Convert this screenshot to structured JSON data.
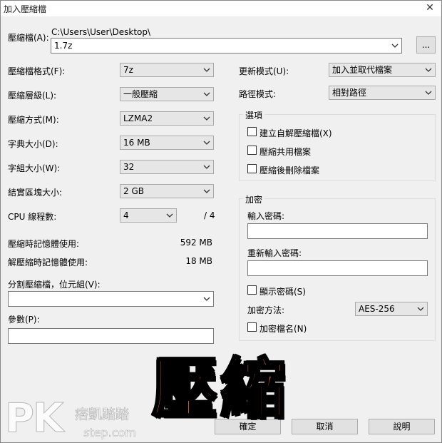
{
  "window": {
    "title": "加入壓縮檔",
    "close_glyph": "✕"
  },
  "archive": {
    "label": "壓縮檔(A):",
    "path": "C:\\Users\\User\\Desktop\\",
    "filename": "1.7z",
    "browse_label": "..."
  },
  "left": {
    "format": {
      "label": "壓縮檔格式(F):",
      "value": "7z"
    },
    "level": {
      "label": "壓縮層級(L):",
      "value": "一般壓縮"
    },
    "method": {
      "label": "壓縮方式(M):",
      "value": "LZMA2"
    },
    "dict": {
      "label": "字典大小(D):",
      "value": "16 MB"
    },
    "word": {
      "label": "字組大小(W):",
      "value": "32"
    },
    "solid": {
      "label": "結實區塊大小:",
      "value": "2 GB"
    },
    "threads": {
      "label": "CPU 線程數:",
      "value": "4",
      "max": "/ 4"
    },
    "mem_comp": {
      "label": "壓縮時記憶體使用:",
      "value": "592 MB"
    },
    "mem_decomp": {
      "label": "解壓縮時記憶體使用:",
      "value": "18 MB"
    },
    "split": {
      "label": "分割壓縮檔，位元組(V):",
      "value": ""
    },
    "params": {
      "label": "參數(P):",
      "value": ""
    }
  },
  "right": {
    "update": {
      "label": "更新模式(U):",
      "value": "加入並取代檔案"
    },
    "path": {
      "label": "路徑模式:",
      "value": "相對路徑"
    },
    "options": {
      "title": "選項",
      "sfx": "建立自解壓縮檔(X)",
      "shared": "壓縮共用檔案",
      "delete": "壓縮後刪除檔案"
    },
    "encryption": {
      "title": "加密",
      "enter_pw": "輸入密碼:",
      "reenter_pw": "重新輸入密碼:",
      "show_pw": "顯示密碼(S)",
      "method_label": "加密方法:",
      "method_value": "AES-256",
      "encrypt_names": "加密檔名(N)"
    }
  },
  "buttons": {
    "ok": "確定",
    "cancel": "取消",
    "help": "說明"
  },
  "overlay": {
    "text": "壓縮"
  },
  "watermark": {
    "logo": "PK",
    "name": "痞凱踏踏",
    "site": "step.com"
  }
}
